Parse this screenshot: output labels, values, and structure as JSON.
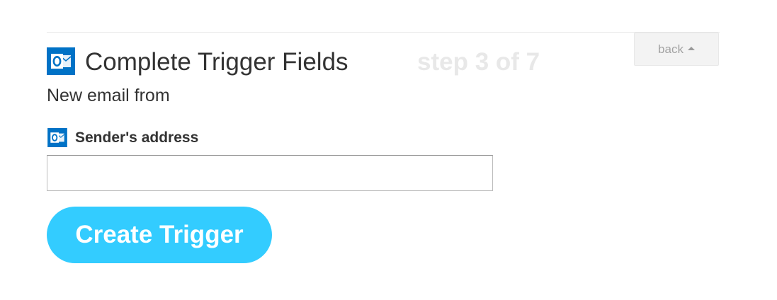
{
  "header": {
    "title": "Complete Trigger Fields",
    "step": "step 3 of 7",
    "back_label": "back",
    "app_icon": "outlook-icon"
  },
  "trigger": {
    "subtitle": "New email from"
  },
  "fields": [
    {
      "icon": "outlook-icon",
      "label": "Sender's address",
      "value": "",
      "placeholder": ""
    }
  ],
  "actions": {
    "create_label": "Create Trigger"
  },
  "colors": {
    "brand_outlook": "#0072c6",
    "button_accent": "#33ccff",
    "step_text": "#e8e8e8",
    "back_bg": "#f3f3f3"
  }
}
